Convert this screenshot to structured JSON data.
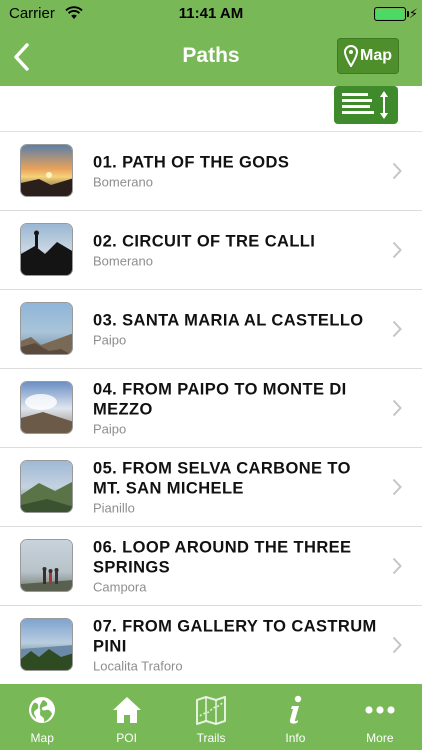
{
  "status_bar": {
    "carrier": "Carrier",
    "time": "11:41 AM",
    "battery_level": 1.0,
    "icons": [
      "wifi-icon",
      "battery-icon",
      "charging-bolt-icon"
    ]
  },
  "nav": {
    "title": "Paths",
    "back_icon": "chevron-left-icon",
    "map_button_label": "Map",
    "map_button_icon": "location-pin-icon"
  },
  "toolbar": {
    "sort_icon": "sort-list-icon"
  },
  "paths": [
    {
      "name": "01. PATH OF THE GODS",
      "place": "Bomerano",
      "thumb": "sunset-coast"
    },
    {
      "name": "02. CIRCUIT OF TRE CALLI",
      "place": "Bomerano",
      "thumb": "climbers-silhouette"
    },
    {
      "name": "03. SANTA MARIA AL CASTELLO",
      "place": "Paipo",
      "thumb": "cliff-sea"
    },
    {
      "name": "04. FROM PAIPO TO MONTE DI MEZZO",
      "place": "Paipo",
      "thumb": "cloudy-peak"
    },
    {
      "name": "05. FROM SELVA CARBONE TO MT. SAN MICHELE",
      "place": "Pianillo",
      "thumb": "green-ridge"
    },
    {
      "name": "06. LOOP AROUND THE THREE SPRINGS",
      "place": "Campora",
      "thumb": "hikers-haze"
    },
    {
      "name": "07. FROM GALLERY TO CASTRUM PINI",
      "place": "Localita Traforo",
      "thumb": "forest-coast"
    }
  ],
  "tabs": [
    {
      "label": "Map",
      "icon": "globe-icon"
    },
    {
      "label": "POI",
      "icon": "home-icon"
    },
    {
      "label": "Trails",
      "icon": "folded-map-icon"
    },
    {
      "label": "Info",
      "icon": "info-icon"
    },
    {
      "label": "More",
      "icon": "more-dots-icon"
    }
  ],
  "colors": {
    "brand_green": "#78b857",
    "button_green": "#4f8f2b",
    "subtitle_gray": "#8e8e8e"
  }
}
